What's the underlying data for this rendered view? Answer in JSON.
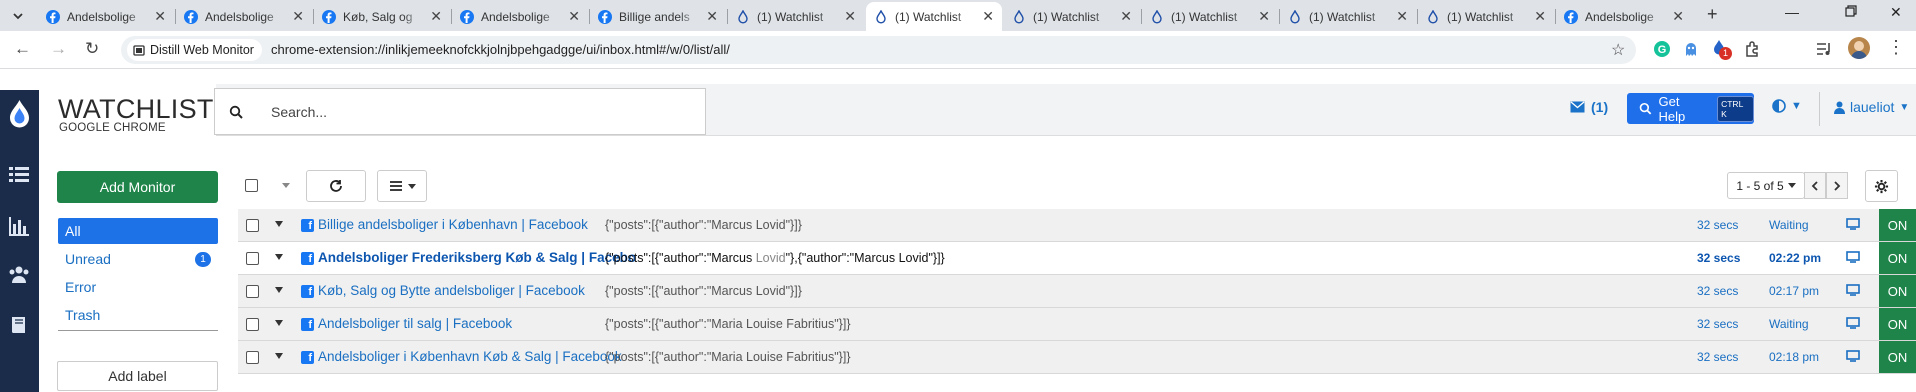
{
  "browser": {
    "tabs": [
      {
        "title": "Andelsbolige",
        "icon": "facebook-icon"
      },
      {
        "title": "Andelsbolige",
        "icon": "facebook-icon"
      },
      {
        "title": "Køb, Salg og",
        "icon": "facebook-icon"
      },
      {
        "title": "Andelsbolige",
        "icon": "facebook-icon"
      },
      {
        "title": "Billige andels",
        "icon": "facebook-icon"
      },
      {
        "title": "(1) Watchlist",
        "icon": "distill-drop-icon"
      },
      {
        "title": "(1) Watchlist",
        "icon": "distill-drop-icon",
        "active": true
      },
      {
        "title": "(1) Watchlist",
        "icon": "distill-drop-icon"
      },
      {
        "title": "(1) Watchlist",
        "icon": "distill-drop-icon"
      },
      {
        "title": "(1) Watchlist",
        "icon": "distill-drop-icon"
      },
      {
        "title": "(1) Watchlist",
        "icon": "distill-drop-icon"
      },
      {
        "title": "Andelsbolige",
        "icon": "facebook-icon"
      }
    ],
    "site_chip": "Distill Web Monitor",
    "url": "chrome-extension://inlikjemeeknofckkjolnjbpehgadgge/ui/inbox.html#/w/0/list/all/",
    "extension_badge": "1"
  },
  "app": {
    "brand_title": "WATCHLIST",
    "brand_subtitle": "GOOGLE CHROME",
    "search_placeholder": "Search...",
    "mail_count": "(1)",
    "get_help": "Get Help",
    "shortcut": "CTRL K",
    "user": "laueliot"
  },
  "sidebar": {
    "add_monitor": "Add Monitor",
    "items": [
      {
        "label": "All",
        "active": true
      },
      {
        "label": "Unread",
        "count": "1"
      },
      {
        "label": "Error"
      },
      {
        "label": "Trash"
      }
    ],
    "add_label": "Add label"
  },
  "list": {
    "pager": "1 - 5 of 5",
    "rows": [
      {
        "name": "Billige andelsboliger i København | Facebook",
        "snippet": "{\"posts\":[{\"author\":\"Marcus Lovid\"}]}",
        "age": "32 secs",
        "status": "Waiting",
        "state": "ON",
        "unread": false
      },
      {
        "name": "Andelsboliger Frederiksberg Køb & Salg | Facebook",
        "snippet_pre": "{\"posts\":[{\"author\":\"Marcus ",
        "snippet_dim1": "Lovid",
        "snippet_mid": "\"},{\"author\":\"Marcus ",
        "snippet_dim2": "",
        "snippet_post": "Lovid\"}]}",
        "age": "32 secs",
        "status": "02:22 pm",
        "state": "ON",
        "unread": true
      },
      {
        "name": "Køb, Salg og Bytte andelsboliger | Facebook",
        "snippet": "{\"posts\":[{\"author\":\"Marcus Lovid\"}]}",
        "age": "32 secs",
        "status": "02:17 pm",
        "state": "ON",
        "unread": false
      },
      {
        "name": "Andelsboliger til salg | Facebook",
        "snippet": "{\"posts\":[{\"author\":\"Maria Louise Fabritius\"}]}",
        "age": "32 secs",
        "status": "Waiting",
        "state": "ON",
        "unread": false
      },
      {
        "name": "Andelsboliger i København Køb & Salg | Facebook",
        "snippet": "{\"posts\":[{\"author\":\"Maria Louise Fabritius\"}]}",
        "age": "32 secs",
        "status": "02:18 pm",
        "state": "ON",
        "unread": false
      }
    ]
  },
  "colors": {
    "rail": "#1a2c4a",
    "primary": "#1d72e8",
    "on_green": "#1e8449",
    "link": "#1a6fc2"
  }
}
